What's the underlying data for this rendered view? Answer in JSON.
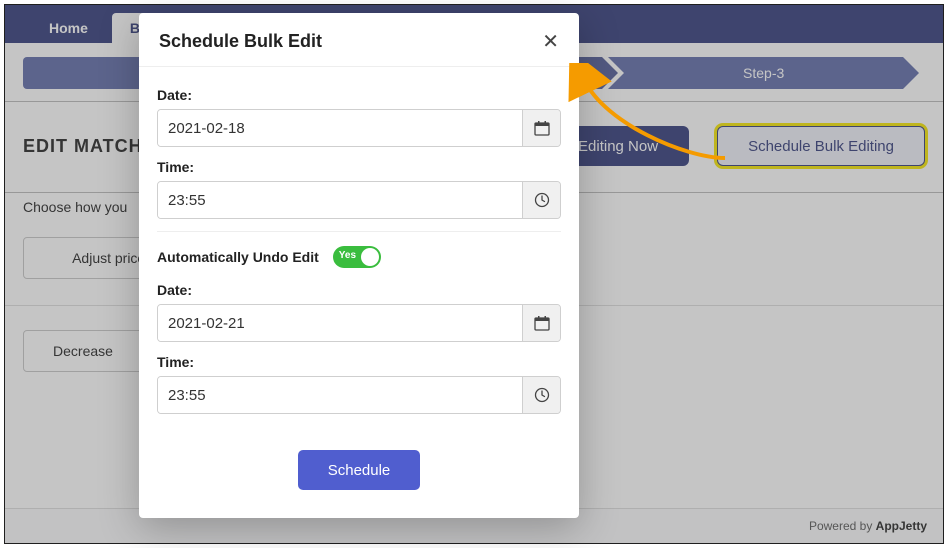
{
  "nav": {
    "home": "Home",
    "bulk": "Bulk Edit"
  },
  "stepper": {
    "step1": " ",
    "step2": " ",
    "step3": "Step-3"
  },
  "page": {
    "heading": "EDIT MATCHED PRODUCTS",
    "start_btn": "Start Bulk Editing Now",
    "schedule_btn": "Schedule Bulk Editing",
    "choose_text": "Choose how you",
    "adjust_text": "Adjust price by",
    "decrease_text": "Decrease"
  },
  "modal": {
    "title": "Schedule Bulk Edit",
    "date1_label": "Date:",
    "date1_value": "2021-02-18",
    "time1_label": "Time:",
    "time1_value": "23:55",
    "undo_label": "Automatically Undo Edit",
    "undo_state": "Yes",
    "date2_label": "Date:",
    "date2_value": "2021-02-21",
    "time2_label": "Time:",
    "time2_value": "23:55",
    "schedule_btn": "Schedule"
  },
  "footer": {
    "prefix": "Powered by ",
    "brand": "AppJetty"
  }
}
